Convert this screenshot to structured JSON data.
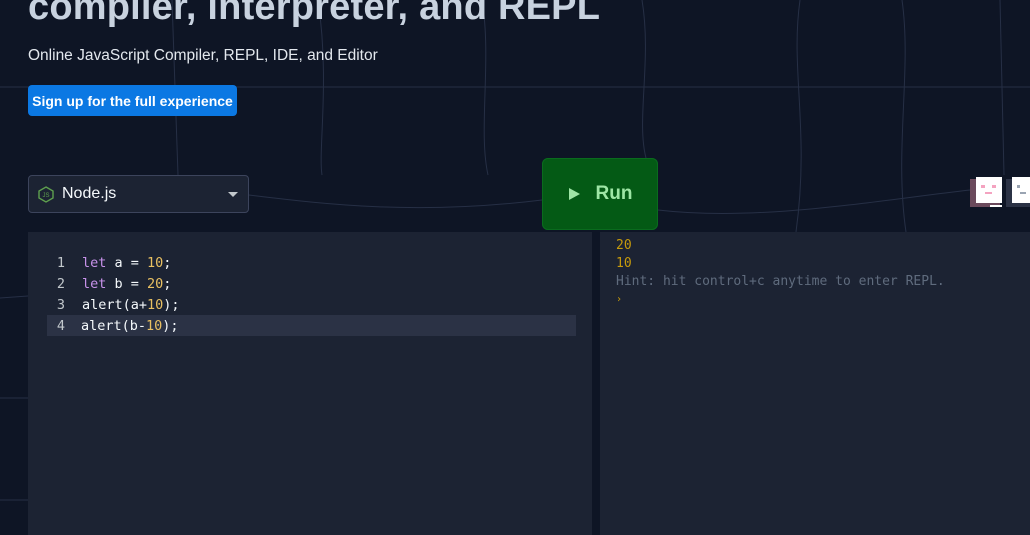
{
  "hero": {
    "title": "compiler, interpreter, and REPL",
    "subtitle": "Online JavaScript Compiler, REPL, IDE, and Editor",
    "signup_label": "Sign up for the full experience"
  },
  "language_select": {
    "selected": "Node.js",
    "icon": "nodejs-icon"
  },
  "run_button": {
    "label": "Run",
    "icon": "play-icon"
  },
  "editor": {
    "lines": [
      {
        "num": "1",
        "tokens": [
          {
            "t": "let",
            "c": "kw"
          },
          {
            "t": " a = ",
            "c": ""
          },
          {
            "t": "10",
            "c": "num"
          },
          {
            "t": ";",
            "c": ""
          }
        ]
      },
      {
        "num": "2",
        "tokens": [
          {
            "t": "let",
            "c": "kw"
          },
          {
            "t": " b = ",
            "c": ""
          },
          {
            "t": "20",
            "c": "num"
          },
          {
            "t": ";",
            "c": ""
          }
        ]
      },
      {
        "num": "3",
        "tokens": [
          {
            "t": "alert(a+",
            "c": ""
          },
          {
            "t": "10",
            "c": "num"
          },
          {
            "t": ");",
            "c": ""
          }
        ]
      },
      {
        "num": "4",
        "tokens": [
          {
            "t": "alert(b-",
            "c": ""
          },
          {
            "t": "10",
            "c": "num"
          },
          {
            "t": ");",
            "c": ""
          }
        ]
      }
    ],
    "active_line": 4
  },
  "console": {
    "output": [
      "20",
      "10"
    ],
    "hint": "Hint: hit control+c anytime to enter REPL.",
    "prompt": "›"
  },
  "colors": {
    "background": "#0e1525",
    "panel": "#1c2333",
    "accent_blue": "#0b78e3",
    "run_green": "#045a15",
    "output_yellow": "#c79b0c"
  }
}
